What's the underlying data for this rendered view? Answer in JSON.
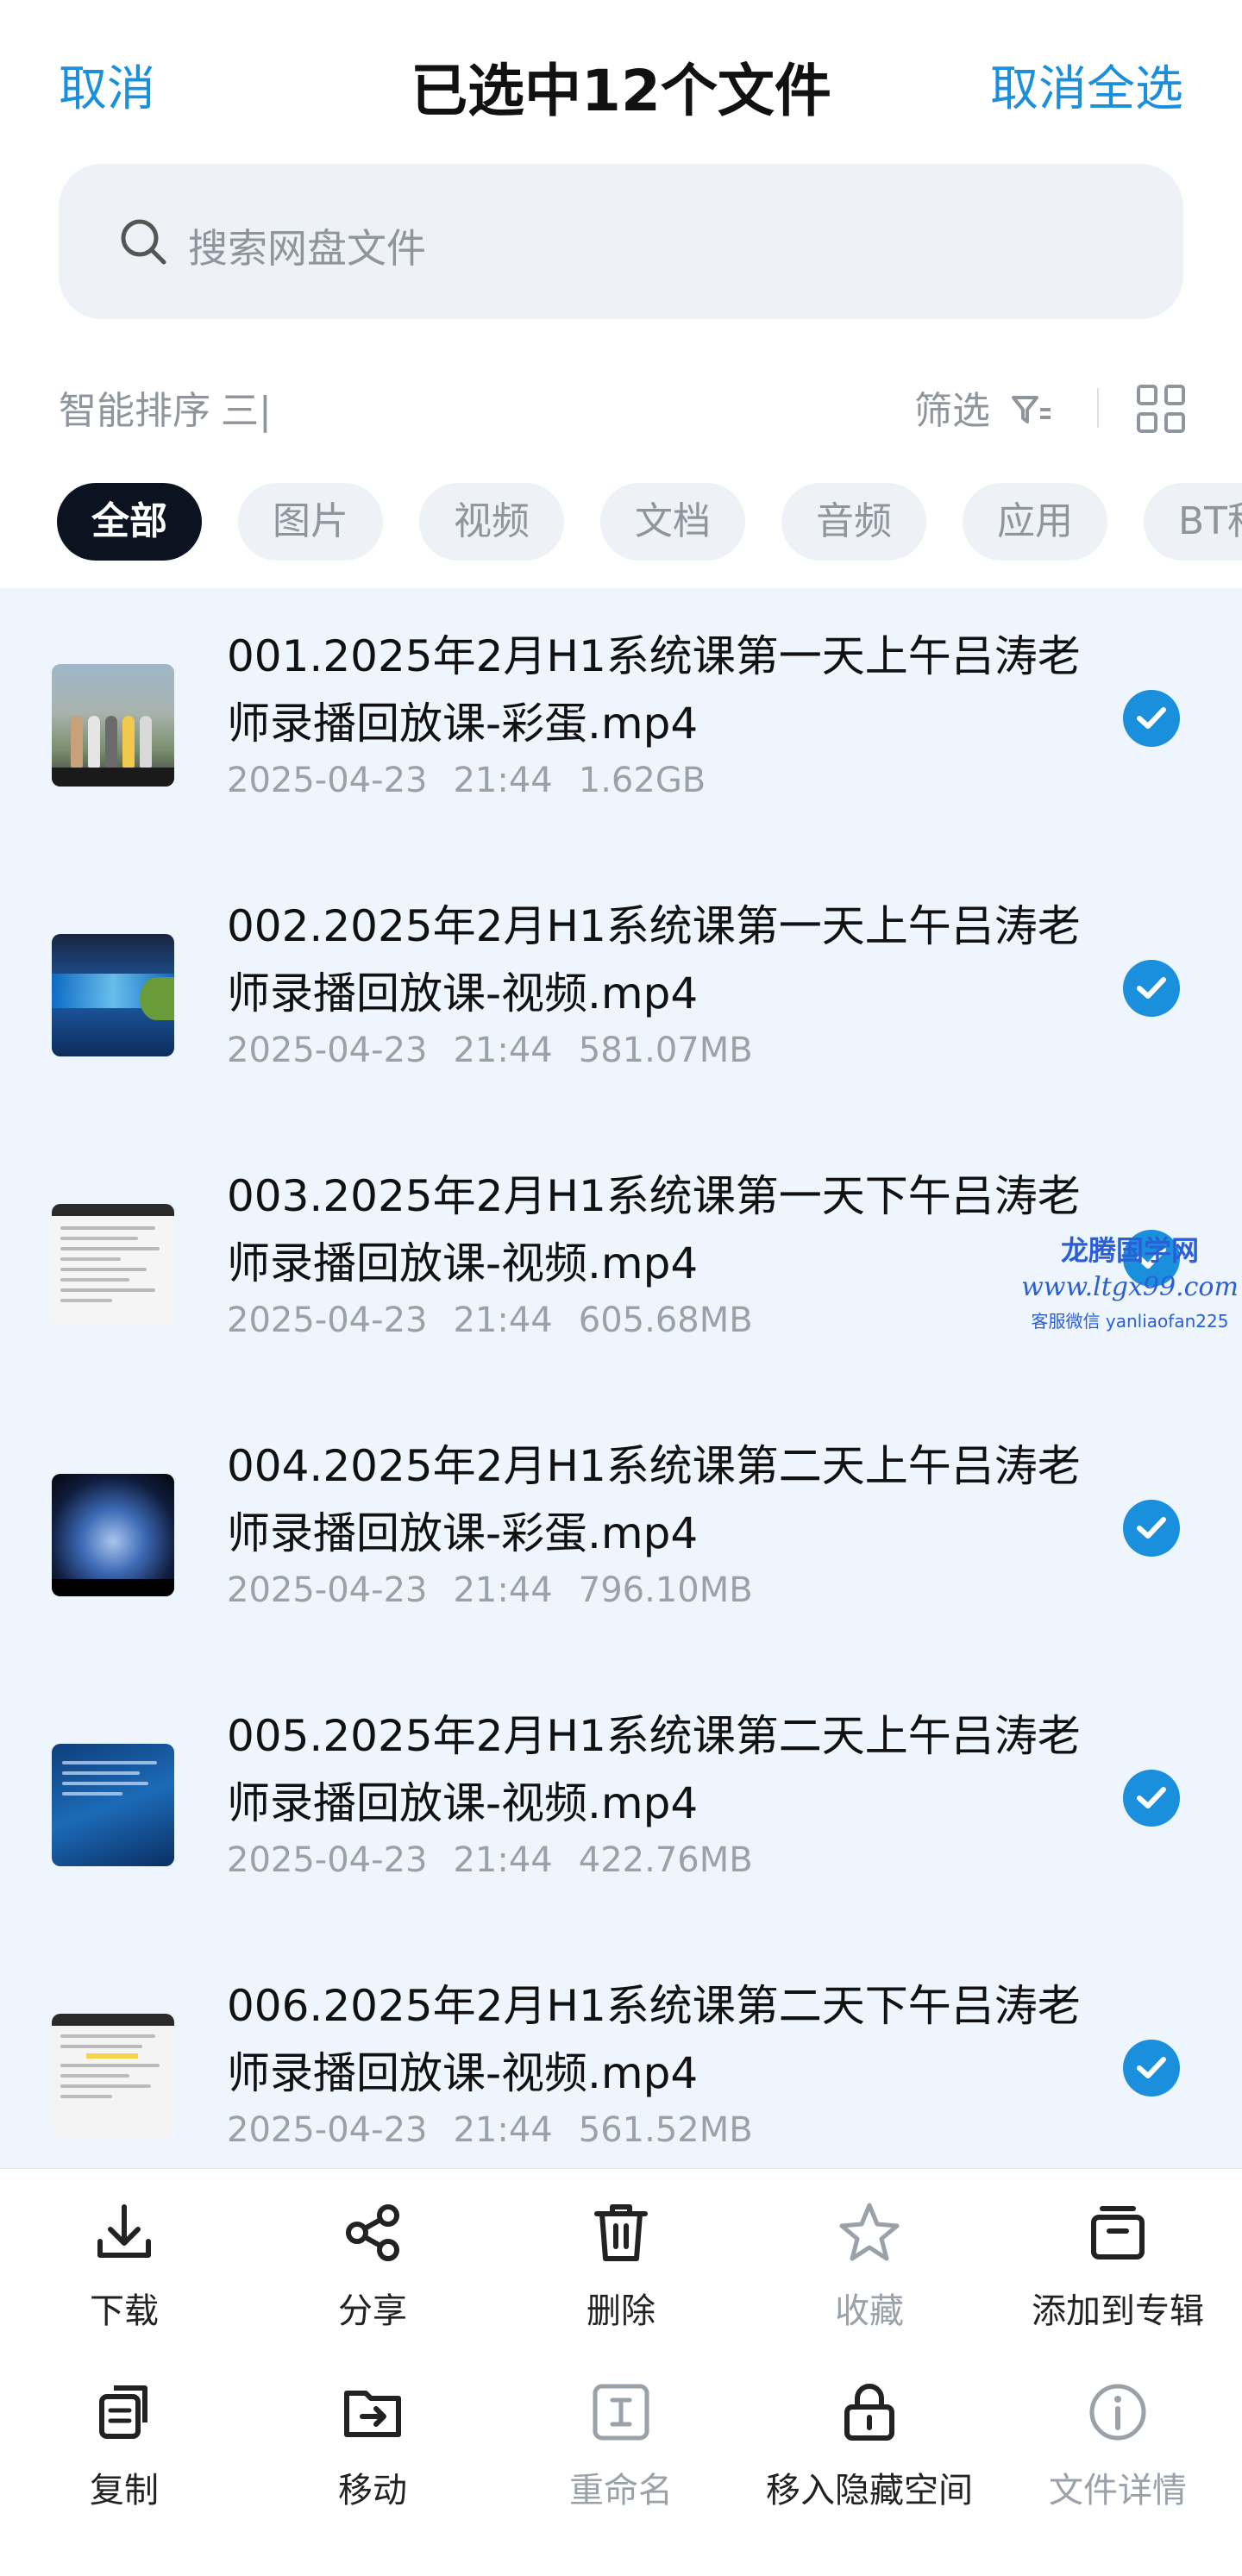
{
  "header": {
    "cancel_label": "取消",
    "title": "已选中12个文件",
    "cancel_all_label": "取消全选"
  },
  "search": {
    "placeholder": "搜索网盘文件"
  },
  "toolbar": {
    "sort_label": "智能排序",
    "sort_glyph": "三|",
    "filter_label": "筛选"
  },
  "tabs": [
    {
      "label": "全部",
      "active": true
    },
    {
      "label": "图片"
    },
    {
      "label": "视频"
    },
    {
      "label": "文档"
    },
    {
      "label": "音频"
    },
    {
      "label": "应用"
    },
    {
      "label": "BT种子"
    }
  ],
  "files": [
    {
      "name": "001.2025年2月H1系统课第一天上午吕涛老师录播回放课-彩蛋.mp4",
      "date": "2025-04-23",
      "time": "21:44",
      "size": "1.62GB",
      "selected": true
    },
    {
      "name": "002.2025年2月H1系统课第一天上午吕涛老师录播回放课-视频.mp4",
      "date": "2025-04-23",
      "time": "21:44",
      "size": "581.07MB",
      "selected": true
    },
    {
      "name": "003.2025年2月H1系统课第一天下午吕涛老师录播回放课-视频.mp4",
      "date": "2025-04-23",
      "time": "21:44",
      "size": "605.68MB",
      "selected": true
    },
    {
      "name": "004.2025年2月H1系统课第二天上午吕涛老师录播回放课-彩蛋.mp4",
      "date": "2025-04-23",
      "time": "21:44",
      "size": "796.10MB",
      "selected": true
    },
    {
      "name": "005.2025年2月H1系统课第二天上午吕涛老师录播回放课-视频.mp4",
      "date": "2025-04-23",
      "time": "21:44",
      "size": "422.76MB",
      "selected": true
    },
    {
      "name": "006.2025年2月H1系统课第二天下午吕涛老师录播回放课-视频.mp4",
      "date": "2025-04-23",
      "time": "21:44",
      "size": "561.52MB",
      "selected": true
    }
  ],
  "watermark": {
    "line1": "龙腾国学网",
    "line2": "www.ltgx99.com",
    "line3": "客服微信 yanliaofan225"
  },
  "actions": [
    {
      "label": "下载",
      "icon": "download-icon",
      "enabled": true
    },
    {
      "label": "分享",
      "icon": "share-icon",
      "enabled": true
    },
    {
      "label": "删除",
      "icon": "trash-icon",
      "enabled": true
    },
    {
      "label": "收藏",
      "icon": "star-icon",
      "enabled": false
    },
    {
      "label": "添加到专辑",
      "icon": "album-icon",
      "enabled": true
    },
    {
      "label": "复制",
      "icon": "copy-icon",
      "enabled": true
    },
    {
      "label": "移动",
      "icon": "move-folder-icon",
      "enabled": true
    },
    {
      "label": "重命名",
      "icon": "rename-icon",
      "enabled": false
    },
    {
      "label": "移入隐藏空间",
      "icon": "lock-icon",
      "enabled": true
    },
    {
      "label": "文件详情",
      "icon": "info-icon",
      "enabled": false
    }
  ],
  "colors": {
    "accent": "#1a8fdc",
    "list_bg": "#eef5fd",
    "muted": "#9aa1a9"
  }
}
